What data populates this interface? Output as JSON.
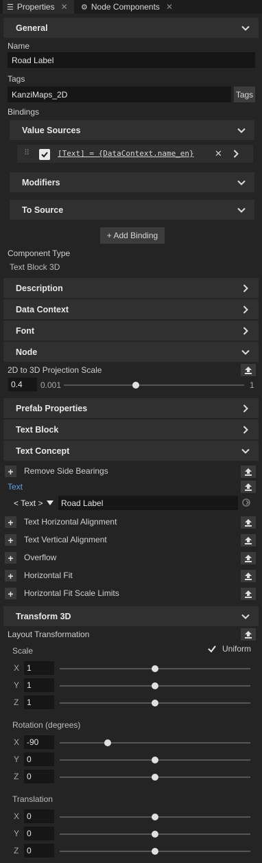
{
  "tabs": [
    {
      "label": "Properties",
      "icon": "list-icon",
      "close": "✕"
    },
    {
      "label": "Node Components",
      "icon": "node-components-icon",
      "close": "✕"
    }
  ],
  "general": {
    "header": "General",
    "name_label": "Name",
    "name_value": "Road Label",
    "tags_label": "Tags",
    "tags_value": "KanziMaps_2D",
    "tags_button": "Tags",
    "bindings_label": "Bindings"
  },
  "bindings": {
    "value_sources": "Value Sources",
    "binding_expression": "[Text] = {DataContext.name_en}",
    "modifiers": "Modifiers",
    "to_source": "To Source",
    "add_binding": "+ Add Binding"
  },
  "component": {
    "label": "Component Type",
    "value": "Text Block 3D"
  },
  "sections": {
    "description": "Description",
    "data_context": "Data Context",
    "font": "Font",
    "node": "Node",
    "prefab_properties": "Prefab Properties",
    "text_block": "Text Block",
    "text_concept": "Text Concept",
    "transform_3d": "Transform 3D"
  },
  "node": {
    "projection_label": "2D to 3D Projection Scale",
    "projection_value": "0.4",
    "slider_min": "0.001",
    "slider_max": "1",
    "slider_fraction": 0.4
  },
  "text_concept": {
    "remove_side_bearings": "Remove Side Bearings",
    "text_label": "Text",
    "text_type": "< Text >",
    "text_value": "Road Label",
    "items": [
      "Text Horizontal Alignment",
      "Text Vertical Alignment",
      "Overflow",
      "Horizontal Fit",
      "Horizontal Fit Scale Limits"
    ]
  },
  "transform": {
    "layout_label": "Layout Transformation",
    "scale_label": "Scale",
    "uniform_label": "Uniform",
    "uniform_checked": true,
    "rotation_label": "Rotation (degrees)",
    "translation_label": "Translation",
    "scale": [
      {
        "axis": "X",
        "value": "1",
        "fraction": 0.5
      },
      {
        "axis": "Y",
        "value": "1",
        "fraction": 0.5
      },
      {
        "axis": "Z",
        "value": "1",
        "fraction": 0.5
      }
    ],
    "rotation": [
      {
        "axis": "X",
        "value": "-90",
        "fraction": 0.25
      },
      {
        "axis": "Y",
        "value": "0",
        "fraction": 0.5
      },
      {
        "axis": "Z",
        "value": "0",
        "fraction": 0.5
      }
    ],
    "translation": [
      {
        "axis": "X",
        "value": "0",
        "fraction": 0.5
      },
      {
        "axis": "Y",
        "value": "0",
        "fraction": 0.5
      },
      {
        "axis": "Z",
        "value": "0",
        "fraction": 0.5
      }
    ]
  },
  "colors": {
    "background": "#242424",
    "section": "#303030",
    "field": "#161616",
    "link_blue": "#5ea3e6"
  }
}
